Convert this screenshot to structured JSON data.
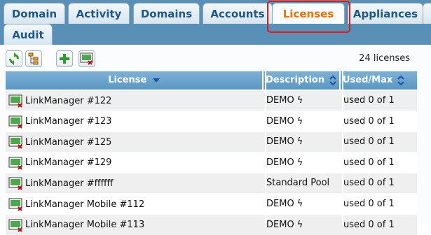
{
  "tabs": [
    {
      "label": "Domain"
    },
    {
      "label": "Activity"
    },
    {
      "label": "Domains"
    },
    {
      "label": "Accounts"
    },
    {
      "label": "Licenses"
    },
    {
      "label": "Appliances"
    },
    {
      "label": "Audit"
    }
  ],
  "toolbar": {
    "icons": [
      "refresh-icon",
      "tree-icon",
      "add-icon",
      "license-delete-icon"
    ],
    "count_label": "24 licenses"
  },
  "table": {
    "columns": [
      "License",
      "Description",
      "Used/Max"
    ],
    "rows": [
      {
        "license": "LinkManager #122",
        "description": "DEMO ϟ",
        "used": "used 0 of 1"
      },
      {
        "license": "LinkManager #123",
        "description": "DEMO ϟ",
        "used": "used 0 of 1"
      },
      {
        "license": "LinkManager #125",
        "description": "DEMO ϟ",
        "used": "used 0 of 1"
      },
      {
        "license": "LinkManager #129",
        "description": "DEMO ϟ",
        "used": "used 0 of 1"
      },
      {
        "license": "LinkManager #ffffff",
        "description": "Standard Pool",
        "used": "used 0 of 1"
      },
      {
        "license": "LinkManager Mobile #112",
        "description": "DEMO ϟ",
        "used": "used 0 of 1"
      },
      {
        "license": "LinkManager Mobile #113",
        "description": "DEMO ϟ",
        "used": "used 0 of 1"
      }
    ]
  },
  "colors": {
    "tabbar": "#5a8fb6",
    "header": "#6aa3cd",
    "active_tab_text": "#e8720c",
    "highlight": "#e01919"
  }
}
